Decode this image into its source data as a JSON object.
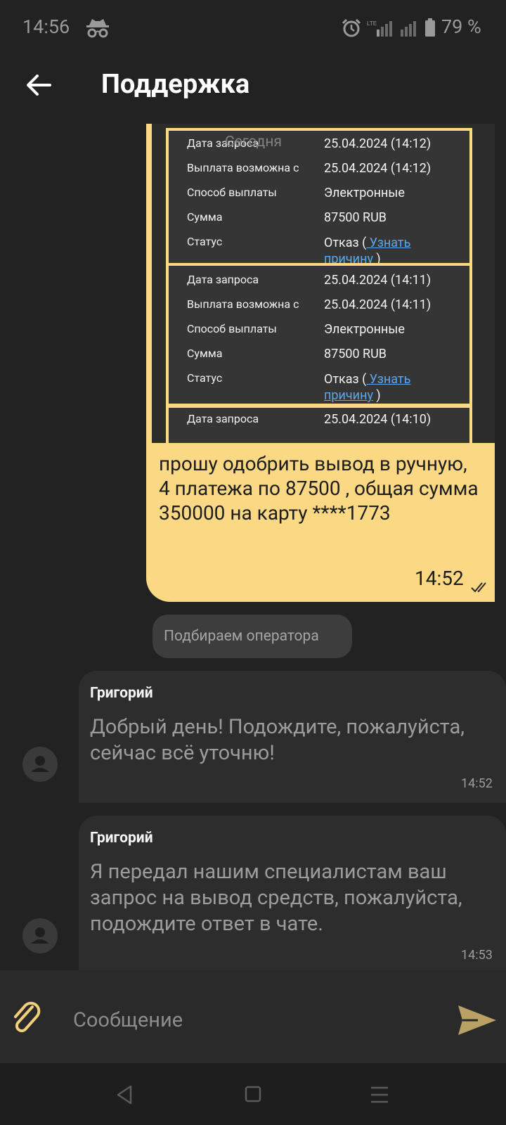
{
  "status_bar": {
    "time": "14:56",
    "battery": "79 %",
    "network": "LTE"
  },
  "header": {
    "title": "Поддержка"
  },
  "outgoing_message": {
    "screenshot": {
      "overlay_label": "Сегодня",
      "blocks": [
        {
          "rows": [
            {
              "label": "Дата запроса",
              "value": "25.04.2024 (14:12)"
            },
            {
              "label": "Выплата возможна с",
              "value": "25.04.2024 (14:12)"
            },
            {
              "label": "Способ выплаты",
              "value": "Электронные"
            },
            {
              "label": "Сумма",
              "value": "87500 RUB"
            }
          ],
          "status_label": "Статус",
          "status_prefix": "Отказ (",
          "status_link_1": " Узнать",
          "status_link_2": "причину",
          "status_suffix": " )"
        },
        {
          "rows": [
            {
              "label": "Дата запроса",
              "value": "25.04.2024 (14:11)"
            },
            {
              "label": "Выплата возможна с",
              "value": "25.04.2024 (14:11)"
            },
            {
              "label": "Способ выплаты",
              "value": "Электронные"
            },
            {
              "label": "Сумма",
              "value": "87500 RUB"
            }
          ],
          "status_label": "Статус",
          "status_prefix": "Отказ (",
          "status_link_1": " Узнать",
          "status_link_2": "причину",
          "status_suffix": " )"
        },
        {
          "rows": [
            {
              "label": "Дата запроса",
              "value": "25.04.2024 (14:10)"
            }
          ]
        }
      ]
    },
    "text": "прошу одобрить вывод в ручную, 4 платежа по 87500 , общая сумма 350000 на карту ****1773",
    "time": "14:52"
  },
  "system_message": "Подбираем оператора",
  "incoming_messages": [
    {
      "sender": "Григорий",
      "text": "Добрый день! Подождите, пожалуйста, сейчас всё уточню!",
      "time": "14:52"
    },
    {
      "sender": "Григорий",
      "text": "Я передал нашим специалистам ваш запрос на вывод средств, пожалуйста, подождите ответ в чате.",
      "time": "14:53"
    }
  ],
  "composer": {
    "placeholder": "Сообщение"
  },
  "icons": {
    "back": "arrow-left-icon",
    "attach": "paperclip-icon",
    "send": "send-icon",
    "avatar": "person-icon",
    "read": "double-check-icon"
  },
  "colors": {
    "outgoing_bubble": "#fbd984",
    "accent_send": "#b9a165",
    "background": "#222222",
    "link": "#5aa6ef"
  }
}
